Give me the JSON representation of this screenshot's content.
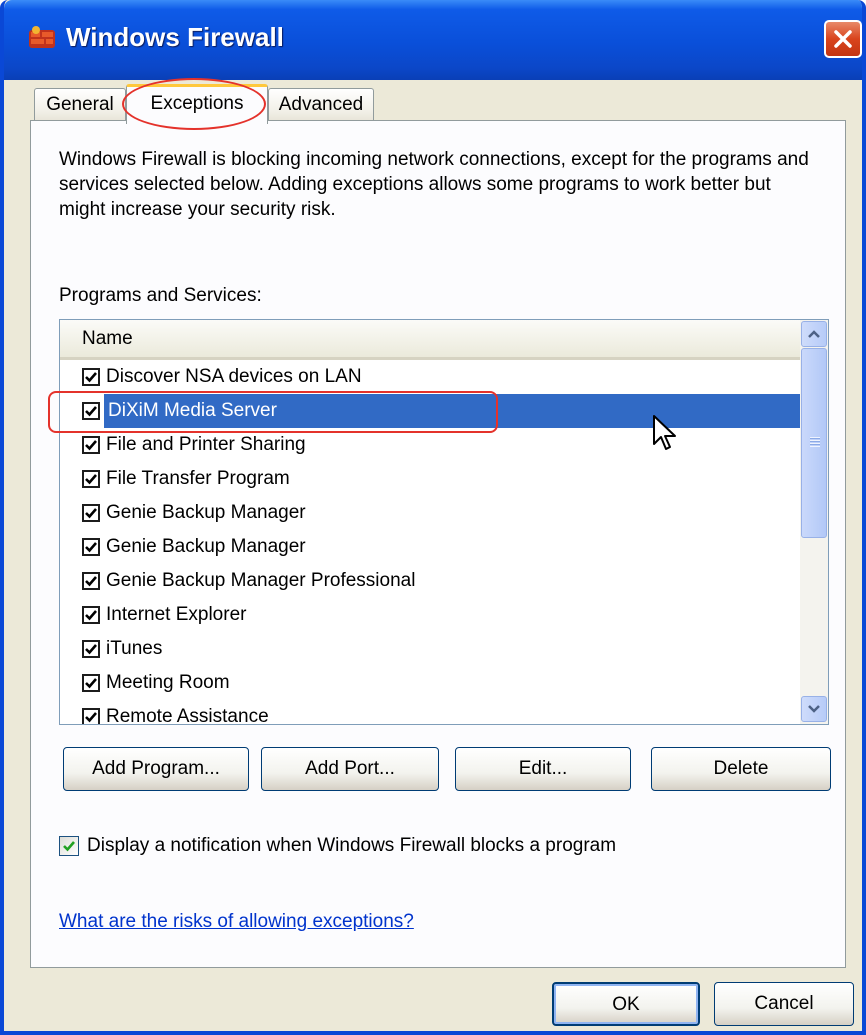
{
  "window": {
    "title": "Windows Firewall",
    "icon": "firewall-brick-icon"
  },
  "tabs": [
    {
      "label": "General",
      "active": false
    },
    {
      "label": "Exceptions",
      "active": true
    },
    {
      "label": "Advanced",
      "active": false
    }
  ],
  "panel": {
    "description": "Windows Firewall is blocking incoming network connections, except for the programs and services selected below. Adding exceptions allows some programs to work better but might increase your security risk.",
    "programs_label": "Programs and Services:",
    "list": {
      "column_header": "Name",
      "items": [
        {
          "label": "Discover NSA devices on LAN",
          "checked": true,
          "selected": false
        },
        {
          "label": "DiXiM Media Server",
          "checked": true,
          "selected": true
        },
        {
          "label": "File and Printer Sharing",
          "checked": true,
          "selected": false
        },
        {
          "label": "File Transfer Program",
          "checked": true,
          "selected": false
        },
        {
          "label": "Genie Backup Manager",
          "checked": true,
          "selected": false
        },
        {
          "label": "Genie Backup Manager",
          "checked": true,
          "selected": false
        },
        {
          "label": "Genie Backup Manager Professional",
          "checked": true,
          "selected": false
        },
        {
          "label": "Internet Explorer",
          "checked": true,
          "selected": false
        },
        {
          "label": "iTunes",
          "checked": true,
          "selected": false
        },
        {
          "label": "Meeting Room",
          "checked": true,
          "selected": false
        },
        {
          "label": "Remote Assistance",
          "checked": true,
          "selected": false
        }
      ]
    },
    "buttons": {
      "add_program": "Add Program...",
      "add_port": "Add Port...",
      "edit": "Edit...",
      "delete": "Delete"
    },
    "notify_label": "Display a notification when Windows Firewall blocks a program",
    "notify_checked": true,
    "risks_link": "What are the risks of allowing exceptions?"
  },
  "footer": {
    "ok": "OK",
    "cancel": "Cancel"
  },
  "colors": {
    "titlebar": "#0a4fd9",
    "selection": "#316ac5",
    "annotation": "#e4322b",
    "link": "#0033cc"
  }
}
